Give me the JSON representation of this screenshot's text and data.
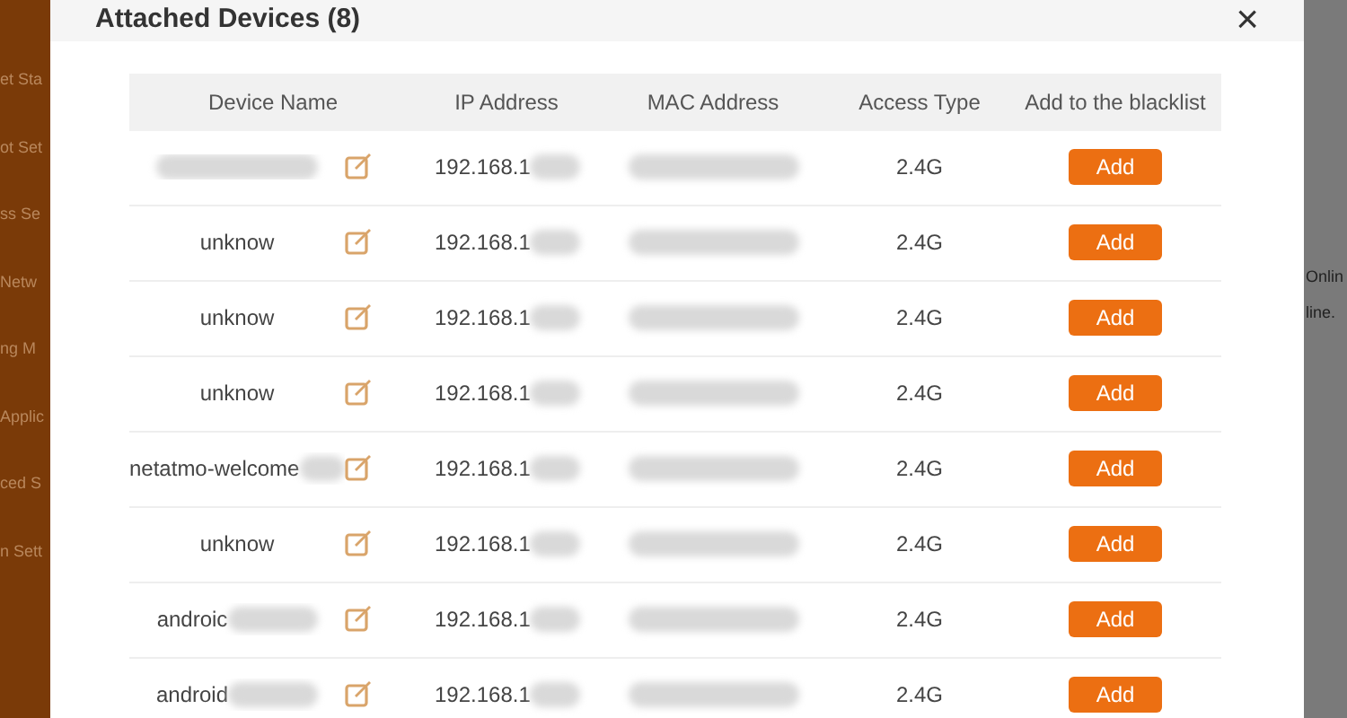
{
  "sidebar": {
    "items": [
      "et Sta",
      "ot Set",
      "ss Se",
      "Netw",
      "ng M",
      "Applic",
      "ced S",
      "n Sett"
    ]
  },
  "background": {
    "texts": [
      "Onlin",
      "line."
    ]
  },
  "dialog": {
    "title": "Attached Devices (8)",
    "close": "×",
    "table": {
      "columns": [
        "Device Name",
        "IP Address",
        "MAC Address",
        "Access Type",
        "Add to the blacklist"
      ],
      "rows": [
        {
          "name": "",
          "name_blurred": true,
          "ip": "192.168.1",
          "access": "2.4G",
          "action": "Add"
        },
        {
          "name": "unknow",
          "name_blurred": false,
          "ip": "192.168.1",
          "access": "2.4G",
          "action": "Add"
        },
        {
          "name": "unknow",
          "name_blurred": false,
          "ip": "192.168.1",
          "access": "2.4G",
          "action": "Add"
        },
        {
          "name": "unknow",
          "name_blurred": false,
          "ip": "192.168.1",
          "access": "2.4G",
          "action": "Add"
        },
        {
          "name": "netatmo-welcome",
          "name_blurred": true,
          "ip": "192.168.1",
          "access": "2.4G",
          "action": "Add"
        },
        {
          "name": "unknow",
          "name_blurred": false,
          "ip": "192.168.1",
          "access": "2.4G",
          "action": "Add"
        },
        {
          "name": "androic",
          "name_blurred": true,
          "ip": "192.168.1",
          "access": "2.4G",
          "action": "Add"
        },
        {
          "name": "android",
          "name_blurred": true,
          "ip": "192.168.1",
          "access": "2.4G",
          "action": "Add"
        }
      ]
    }
  }
}
